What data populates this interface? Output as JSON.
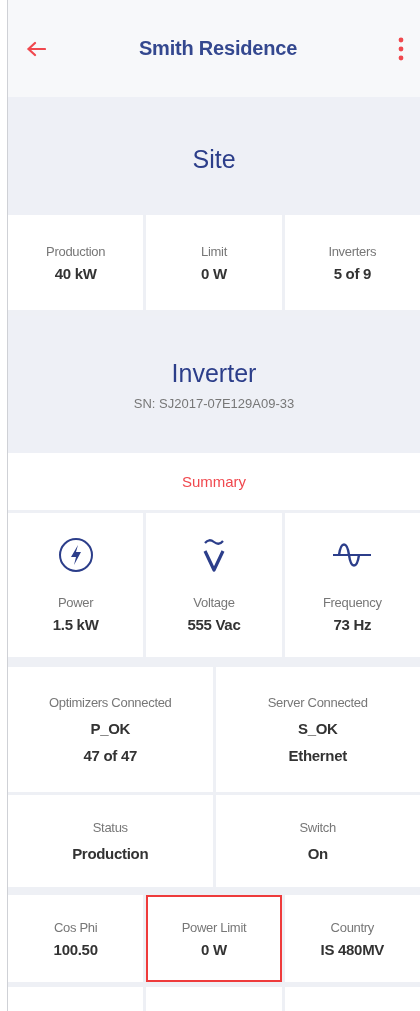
{
  "header": {
    "title": "Smith Residence"
  },
  "site": {
    "title": "Site",
    "stats": [
      {
        "label": "Production",
        "values": [
          "40 kW"
        ]
      },
      {
        "label": "Limit",
        "values": [
          "0 W"
        ]
      },
      {
        "label": "Inverters",
        "values": [
          "5 of 9"
        ]
      }
    ]
  },
  "inverter": {
    "title": "Inverter",
    "serial": "SN: SJ2017-07E129A09-33",
    "section": "Summary",
    "metrics": [
      {
        "kind": "power",
        "label": "Power",
        "value": "1.5 kW"
      },
      {
        "kind": "voltage",
        "label": "Voltage",
        "value": "555 Vac"
      },
      {
        "kind": "frequency",
        "label": "Frequency",
        "value": "73 Hz"
      }
    ],
    "details": [
      {
        "label": "Optimizers Connected",
        "values": [
          "P_OK",
          "47 of 47"
        ]
      },
      {
        "label": "Server Connected",
        "values": [
          "S_OK",
          "Ethernet"
        ]
      },
      {
        "label": "Status",
        "values": [
          "Production"
        ]
      },
      {
        "label": "Switch",
        "values": [
          "On"
        ]
      }
    ],
    "more": [
      {
        "label": "Cos Phi",
        "values": [
          "100.50"
        ],
        "highlighted": false
      },
      {
        "label": "Power Limit",
        "values": [
          "0 W"
        ],
        "highlighted": true
      },
      {
        "label": "Country",
        "values": [
          "IS 480MV"
        ],
        "highlighted": false
      }
    ]
  }
}
